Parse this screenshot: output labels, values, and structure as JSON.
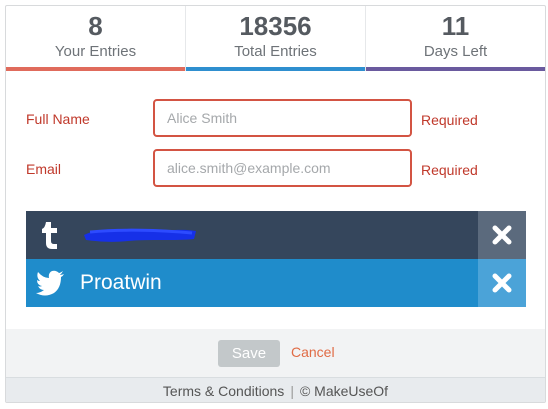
{
  "stats": [
    {
      "value": "8",
      "label": "Your Entries",
      "color": "#e06b5c"
    },
    {
      "value": "18356",
      "label": "Total Entries",
      "color": "#2f8fcf"
    },
    {
      "value": "11",
      "label": "Days Left",
      "color": "#6a5a9e"
    }
  ],
  "form": {
    "name_label": "Full Name",
    "name_placeholder": "Alice Smith",
    "name_required": "Required",
    "email_label": "Email",
    "email_placeholder": "alice.smith@example.com",
    "email_required": "Required"
  },
  "social": {
    "tumblr": {
      "icon": "tumblr-icon",
      "color": "#35465c"
    },
    "twitter": {
      "icon": "twitter-icon",
      "name": "Proatwin",
      "color": "#1f8ccb"
    }
  },
  "actions": {
    "save_label": "Save",
    "cancel_label": "Cancel"
  },
  "footer": {
    "terms": "Terms & Conditions",
    "separator": "|",
    "copyright": "© MakeUseOf"
  }
}
